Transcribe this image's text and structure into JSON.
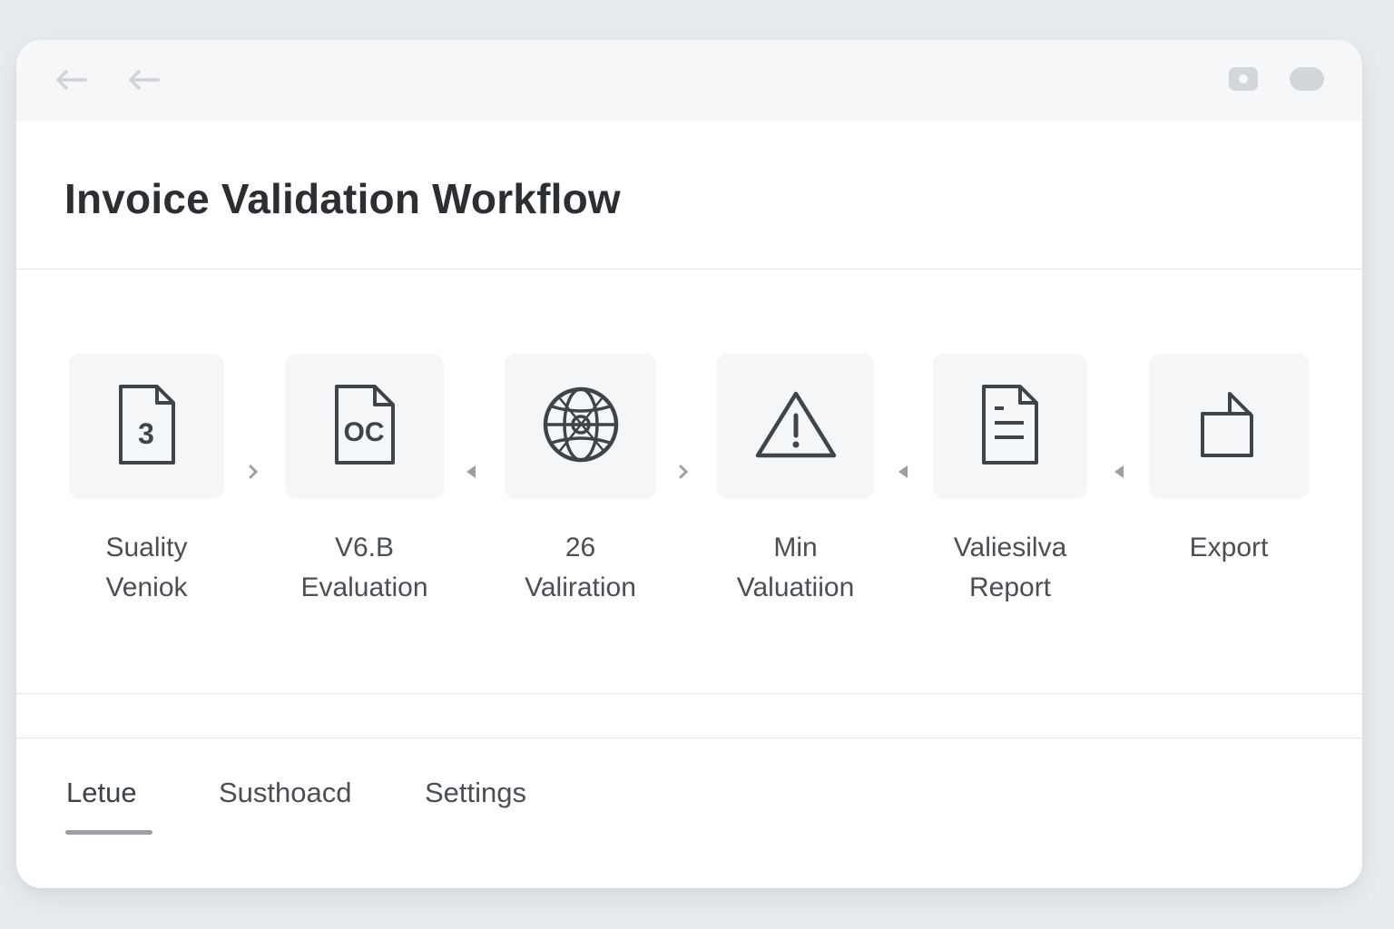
{
  "titlebar": {
    "back_icon": "arrow-left-icon",
    "forward_icon": "arrow-left-icon",
    "window_controls": [
      "rounded-rect-icon",
      "pill-icon"
    ]
  },
  "header": {
    "title": "Invoice Validation Workflow"
  },
  "steps": [
    {
      "label": "Suality\nVeniok",
      "icon": "document-3-icon",
      "icon_text": "3"
    },
    {
      "label": "V6.B\nEvaluation",
      "icon": "document-oc-icon",
      "icon_text": "OC"
    },
    {
      "label": "26\nValiration",
      "icon": "globe-icon"
    },
    {
      "label": "Min\nValuatiion",
      "icon": "warning-icon"
    },
    {
      "label": "Valiesilva\nReport",
      "icon": "report-document-icon"
    },
    {
      "label": "Export",
      "icon": "export-folder-icon"
    }
  ],
  "separators": [
    "›",
    "◂",
    "›",
    "◂",
    "◂"
  ],
  "tabs": [
    {
      "label": "Letue",
      "active": true
    },
    {
      "label": "Susthoacd",
      "active": false
    },
    {
      "label": "Settings",
      "active": false
    }
  ],
  "colors": {
    "background": "#e9ecef",
    "card": "#ffffff",
    "titlebar": "#f6f7f8",
    "tile": "#f5f6f7",
    "title_text": "#2b2f33",
    "label_text": "#4a4f55",
    "icon_stroke": "#3f4448"
  }
}
